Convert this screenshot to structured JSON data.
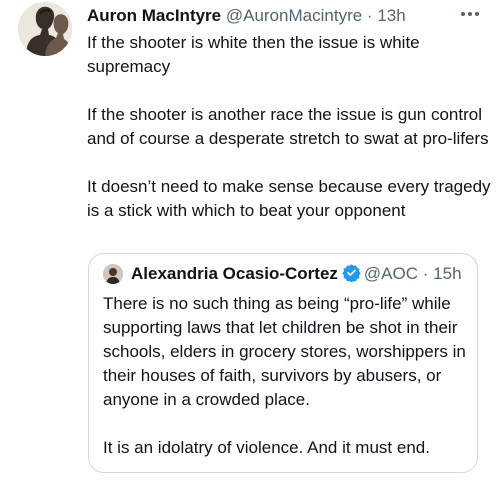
{
  "tweet": {
    "author": {
      "name": "Auron MacIntyre",
      "handle": "@AuronMacintyre",
      "separator": "·",
      "time": "13h"
    },
    "paragraphs": [
      "If the shooter is white then the issue is white supremacy",
      "If the shooter is another race the issue is gun control and of course a desperate stretch to swat at pro-lifers",
      "It doesn’t need to make sense because every tragedy is a stick with which to beat your opponent"
    ],
    "more_icon": "ellipsis-icon"
  },
  "quoted_tweet": {
    "author": {
      "name": "Alexandria Ocasio-Cortez",
      "handle": "@AOC",
      "separator": "·",
      "time": "15h",
      "verified": true
    },
    "paragraphs": [
      "There is no such thing as being “pro-life” while supporting laws that let children be shot in their schools, elders in grocery stores, worshippers in their houses of faith, survivors by abusers, or anyone in a crowded place.",
      "It is an idolatry of violence. And it must end."
    ]
  },
  "colors": {
    "text": "#0f1419",
    "secondary_text": "#536471",
    "border": "#cfd9de",
    "verified_badge": "#1d9bf0"
  }
}
